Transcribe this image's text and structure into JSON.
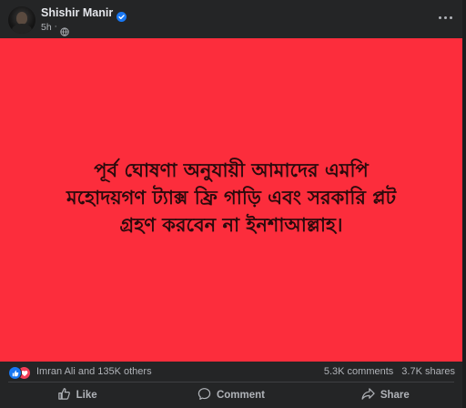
{
  "post": {
    "author": "Shishir Manir",
    "time": "5h",
    "separator": "·",
    "image_text_lines": [
      "পূর্ব ঘোষণা অনুযায়ী আমাদের এমপি",
      "মহোদয়গণ ট্যাক্স ফ্রি গাড়ি এবং সরকারি প্লট",
      "গ্রহণ করবেন না ইনশাআল্লাহ।"
    ],
    "image_background": "#fc2d3c"
  },
  "reactions": {
    "summary": "Imran Ali and 135K others",
    "comments": "5.3K comments",
    "shares": "3.7K shares"
  },
  "actions": {
    "like": "Like",
    "comment": "Comment",
    "share": "Share"
  },
  "icons": [
    "verified-badge-icon",
    "globe-icon",
    "more-options-icon",
    "like-reaction-icon",
    "love-reaction-icon",
    "like-icon",
    "comment-icon",
    "share-icon"
  ],
  "colors": {
    "background": "#242526",
    "accent_blue": "#1877f2",
    "love_red": "#f33e58",
    "muted_text": "#b0b3b8"
  }
}
